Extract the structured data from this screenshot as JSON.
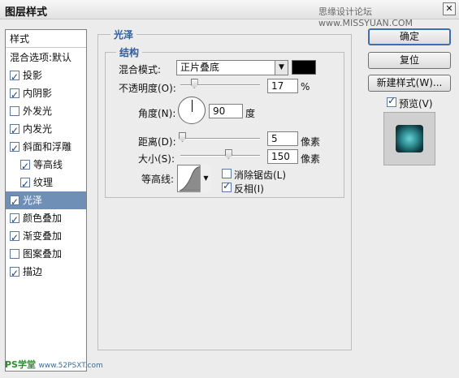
{
  "window": {
    "title": "图层样式",
    "watermark_top": "思缘设计论坛 www.MISSYUAN.COM",
    "close_label": "✕"
  },
  "sidebar": {
    "header": "样式",
    "items": [
      {
        "label": "混合选项:默认",
        "has_checkbox": false,
        "checked": false,
        "active": false
      },
      {
        "label": "投影",
        "has_checkbox": true,
        "checked": true,
        "active": false
      },
      {
        "label": "内阴影",
        "has_checkbox": true,
        "checked": true,
        "active": false
      },
      {
        "label": "外发光",
        "has_checkbox": true,
        "checked": false,
        "active": false
      },
      {
        "label": "内发光",
        "has_checkbox": true,
        "checked": true,
        "active": false
      },
      {
        "label": "斜面和浮雕",
        "has_checkbox": true,
        "checked": true,
        "active": false
      },
      {
        "label": "等高线",
        "has_checkbox": true,
        "checked": true,
        "active": false,
        "sub": true
      },
      {
        "label": "纹理",
        "has_checkbox": true,
        "checked": true,
        "active": false,
        "sub": true
      },
      {
        "label": "光泽",
        "has_checkbox": true,
        "checked": true,
        "active": true
      },
      {
        "label": "颜色叠加",
        "has_checkbox": true,
        "checked": true,
        "active": false
      },
      {
        "label": "渐变叠加",
        "has_checkbox": true,
        "checked": true,
        "active": false
      },
      {
        "label": "图案叠加",
        "has_checkbox": true,
        "checked": false,
        "active": false
      },
      {
        "label": "描边",
        "has_checkbox": true,
        "checked": true,
        "active": false
      }
    ]
  },
  "panel": {
    "outer_title": "光泽",
    "inner_title": "结构",
    "blend_mode_label": "混合模式:",
    "blend_mode_value": "正片叠底",
    "blend_color": "#000000",
    "opacity_label": "不透明度(O):",
    "opacity_value": "17",
    "opacity_unit": "%",
    "opacity_fraction": 0.17,
    "angle_label": "角度(N):",
    "angle_value": "90",
    "angle_unit": "度",
    "distance_label": "距离(D):",
    "distance_value": "5",
    "distance_unit": "像素",
    "distance_fraction": 0.02,
    "size_label": "大小(S):",
    "size_value": "150",
    "size_unit": "像素",
    "size_fraction": 0.6,
    "contour_label": "等高线:",
    "antialias_label": "消除锯齿(L)",
    "antialias_checked": false,
    "invert_label": "反相(I)",
    "invert_checked": true
  },
  "buttons": {
    "ok": "确定",
    "reset": "复位",
    "new_style": "新建样式(W)...",
    "preview_label": "预览(V)",
    "preview_checked": true
  },
  "watermark_bottom": {
    "brand": "PS学堂",
    "site": "www.52PSXT.com"
  }
}
